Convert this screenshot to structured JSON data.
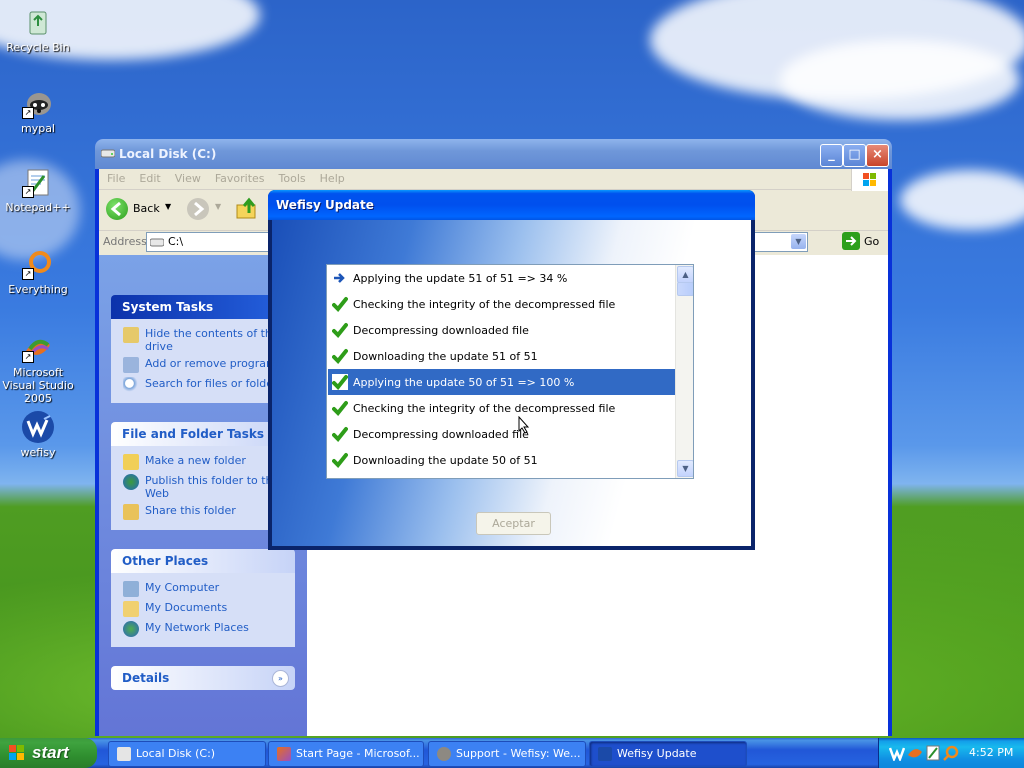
{
  "desktop": {
    "icons": [
      {
        "label": "Recycle Bin"
      },
      {
        "label": "mypal"
      },
      {
        "label": "Notepad++"
      },
      {
        "label": "Everything"
      },
      {
        "label": "Microsoft Visual Studio 2005"
      },
      {
        "label": "wefisy"
      }
    ]
  },
  "explorer": {
    "title": "Local Disk (C:)",
    "menu": [
      "File",
      "Edit",
      "View",
      "Favorites",
      "Tools",
      "Help"
    ],
    "toolbar": {
      "back_label": "Back"
    },
    "address": {
      "label": "Address",
      "value": "C:\\",
      "go_label": "Go"
    },
    "system_tasks": {
      "title": "System Tasks",
      "items": [
        "Hide the contents of this drive",
        "Add or remove programs",
        "Search for files or folders"
      ]
    },
    "file_folder_tasks": {
      "title": "File and Folder Tasks",
      "items": [
        "Make a new folder",
        "Publish this folder to the Web",
        "Share this folder"
      ]
    },
    "other_places": {
      "title": "Other Places",
      "items": [
        "My Computer",
        "My Documents",
        "My Network Places"
      ]
    },
    "details": {
      "title": "Details"
    }
  },
  "dialog": {
    "title": "Wefisy Update",
    "log": [
      {
        "icon": "arrow-icon",
        "text": "Applying the update 51 of 51  => 34 %"
      },
      {
        "icon": "checkmark-icon",
        "text": "Checking the integrity of the decompressed file"
      },
      {
        "icon": "checkmark-icon",
        "text": "Decompressing downloaded file"
      },
      {
        "icon": "checkmark-icon",
        "text": "Downloading the update 51 of 51"
      },
      {
        "icon": "checkmark-icon",
        "text": "Applying the update 50 of 51  => 100 %",
        "selected": true
      },
      {
        "icon": "checkmark-icon",
        "text": "Checking the integrity of the decompressed file"
      },
      {
        "icon": "checkmark-icon",
        "text": "Decompressing downloaded file"
      },
      {
        "icon": "checkmark-icon",
        "text": "Downloading the update 50 of 51"
      }
    ],
    "accept_label": "Aceptar"
  },
  "taskbar": {
    "start_label": "start",
    "tasks": [
      {
        "label": "Local Disk (C:)"
      },
      {
        "label": "Start Page - Microsof..."
      },
      {
        "label": "Support - Wefisy: We..."
      },
      {
        "label": "Wefisy Update"
      }
    ],
    "clock": "4:52 PM"
  },
  "colors": {
    "xp_blue": "#0054e3",
    "selection": "#316ac5",
    "start_green": "#3fa33f",
    "check_green": "#2e9d19"
  }
}
